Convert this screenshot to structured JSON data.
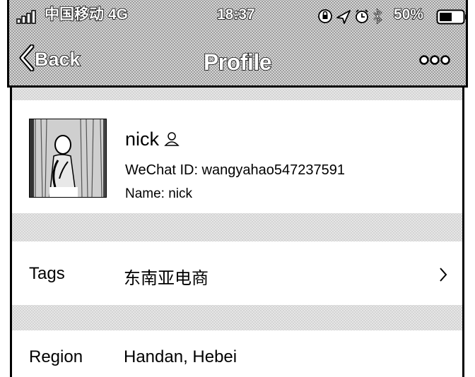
{
  "status_bar": {
    "carrier": "中国移动",
    "network": "4G",
    "time": "18:37",
    "battery_percent": "50%"
  },
  "nav": {
    "back_label": "Back",
    "title": "Profile"
  },
  "profile": {
    "nickname": "nick",
    "wechat_id": "WeChat ID: wangyahao547237591",
    "name": "Name: nick"
  },
  "rows": {
    "tags": {
      "label": "Tags",
      "value": "东南亚电商"
    },
    "region": {
      "label": "Region",
      "value": "Handan, Hebei"
    }
  }
}
